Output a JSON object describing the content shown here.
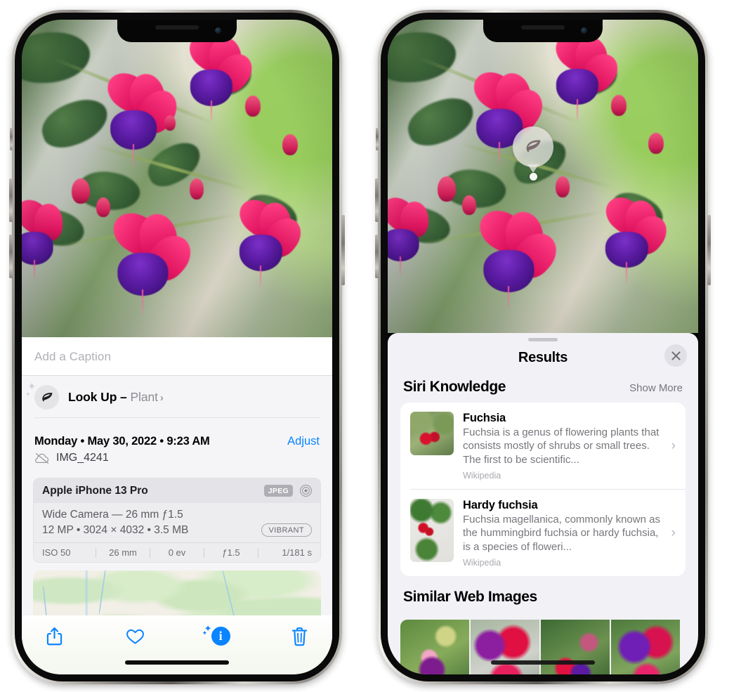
{
  "left_phone": {
    "photo": {
      "alt": "fuchsia-flowers-photo"
    },
    "caption_placeholder": "Add a Caption",
    "caption_value": "",
    "lookup": {
      "icon": "leaf-icon",
      "label": "Look Up – ",
      "subject": "Plant",
      "chevron": "›"
    },
    "metadata": {
      "date_line": "Monday • May 30, 2022 • 9:23 AM",
      "adjust_label": "Adjust",
      "cloud_icon": "cloud-slash-icon",
      "filename": "IMG_4241"
    },
    "exif": {
      "device": "Apple iPhone 13 Pro",
      "format_badge": "JPEG",
      "lens_icon": "aperture-icon",
      "lens_line": "Wide Camera — 26 mm ƒ1.5",
      "size_line": "12 MP • 3024 × 4032 • 3.5 MB",
      "style_badge": "VIBRANT",
      "settings": [
        "ISO 50",
        "26 mm",
        "0 ev",
        "ƒ1.5",
        "1/181 s"
      ]
    },
    "map": {
      "name": "location-map-card",
      "pin": "photo-pin"
    },
    "toolbar": [
      {
        "name": "share-button",
        "icon": "share-icon"
      },
      {
        "name": "favorite-button",
        "icon": "heart-icon"
      },
      {
        "name": "info-button",
        "icon": "info-sparkle-icon",
        "glyph": "i"
      },
      {
        "name": "delete-button",
        "icon": "trash-icon"
      }
    ]
  },
  "right_phone": {
    "badge": {
      "icon": "leaf-icon",
      "name": "visual-look-up-badge"
    },
    "sheet": {
      "title": "Results",
      "close_icon": "close-icon",
      "sections": [
        {
          "title": "Siri Knowledge",
          "action": "Show More",
          "items": [
            {
              "title": "Fuchsia",
              "description": "Fuchsia is a genus of flowering plants that consists mostly of shrubs or small trees. The first to be scientific...",
              "source": "Wikipedia",
              "thumb": "fuchsia-thumb"
            },
            {
              "title": "Hardy fuchsia",
              "description": "Fuchsia magellanica, commonly known as the hummingbird fuchsia or hardy fuchsia, is a species of floweri...",
              "source": "Wikipedia",
              "thumb": "hardy-fuchsia-thumb"
            }
          ]
        },
        {
          "title": "Similar Web Images",
          "action": "",
          "thumbs": [
            "web-image-1",
            "web-image-2",
            "web-image-3",
            "web-image-4"
          ]
        }
      ]
    }
  },
  "colors": {
    "accent_blue": "#0a84ff",
    "sheet_bg": "#f2f1f6",
    "card_white": "#ffffff",
    "secondary_text": "#8e8e93",
    "exif_card": "#ededf0"
  }
}
